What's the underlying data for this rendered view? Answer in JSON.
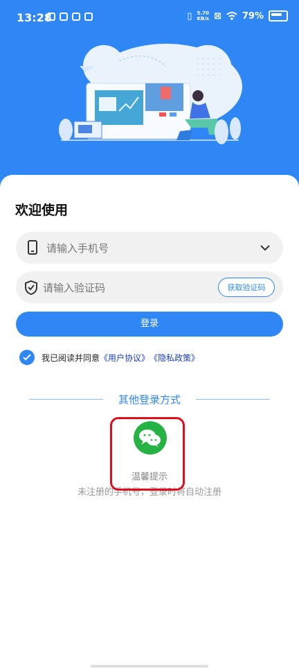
{
  "status_bar": {
    "time": "13:28",
    "speed_value": "5.70",
    "speed_unit": "KB/s",
    "battery": "79%"
  },
  "login": {
    "welcome": "欢迎使用",
    "phone_placeholder": "请输入手机号",
    "code_placeholder": "请输入验证码",
    "get_code": "获取验证码",
    "login_button": "登录",
    "agree_prefix": "我已阅读并同意",
    "user_agreement": "《用户协议》",
    "privacy_policy": "《隐私政策》"
  },
  "other_login": {
    "title": "其他登录方式",
    "tip_title": "温馨提示",
    "tip_text": "未注册的手机号，登录时将自动注册"
  },
  "colors": {
    "primary": "#2f87f5",
    "wechat": "#27b244",
    "highlight": "#e00e1d",
    "link": "#1a3cc8"
  }
}
